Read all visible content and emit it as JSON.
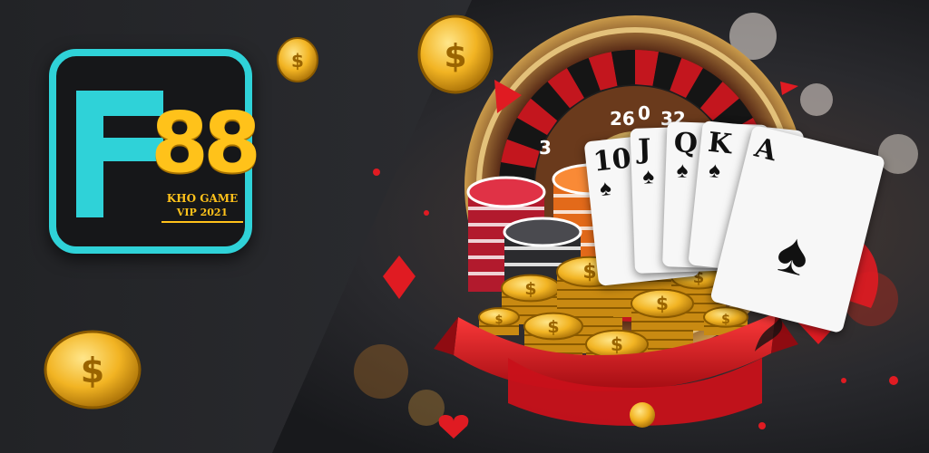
{
  "logo": {
    "letter": "F",
    "number": "88",
    "subtitle_line1": "KHO GAME",
    "subtitle_line2": "VIP 2021"
  },
  "cards": [
    {
      "rank": "10",
      "suit": "♠"
    },
    {
      "rank": "J",
      "suit": "♠"
    },
    {
      "rank": "Q",
      "suit": "♠"
    },
    {
      "rank": "K",
      "suit": "♠"
    },
    {
      "rank": "A",
      "suit": "♠"
    }
  ],
  "roulette_numbers": [
    "3",
    "26",
    "0",
    "32"
  ],
  "coin_symbol": "$",
  "icons": [
    "coin-icon",
    "spade-icon",
    "diamond-icon",
    "heart-icon",
    "roulette-wheel",
    "chip-stack-icon"
  ],
  "colors": {
    "accent_cyan": "#2fd2d8",
    "gold": "#ffc21a",
    "ribbon_red": "#d6131c",
    "background": "#1c1d20"
  }
}
